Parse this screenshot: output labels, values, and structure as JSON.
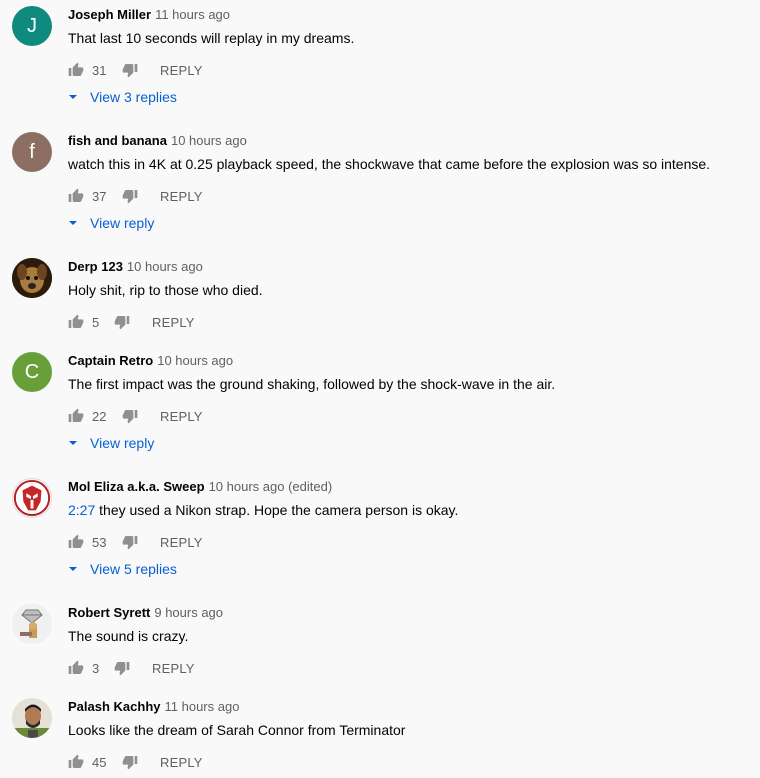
{
  "comments": [
    {
      "author": "Joseph Miller",
      "time": "11 hours ago",
      "text": "That last 10 seconds will replay in my dreams.",
      "likes": "31",
      "reply_label": "REPLY",
      "replies_label": "View 3 replies",
      "avatar_letter": "J",
      "avatar_color": "#0f8a7e"
    },
    {
      "author": "fish and banana",
      "time": "10 hours ago",
      "text": "watch this in 4K at 0.25 playback speed, the shockwave that came before the explosion was so intense.",
      "likes": "37",
      "reply_label": "REPLY",
      "replies_label": "View reply",
      "avatar_letter": "f",
      "avatar_color": "#8d6e63"
    },
    {
      "author": "Derp 123",
      "time": "10 hours ago",
      "text": "Holy shit, rip to those who died.",
      "likes": "5",
      "reply_label": "REPLY",
      "avatar_icon": "dog-photo-avatar"
    },
    {
      "author": "Captain Retro",
      "time": "10 hours ago",
      "text": "The first impact was the ground shaking, followed by the shock-wave in the air.",
      "likes": "22",
      "reply_label": "REPLY",
      "replies_label": "View reply",
      "avatar_letter": "C",
      "avatar_color": "#689f38"
    },
    {
      "author": "Mol Eliza a.k.a. Sweep",
      "time": "10 hours ago (edited)",
      "timestamp_link": "2:27",
      "text": "they used a Nikon strap. Hope the camera person is okay.",
      "likes": "53",
      "reply_label": "REPLY",
      "replies_label": "View 5 replies",
      "avatar_icon": "autobot-logo-avatar"
    },
    {
      "author": "Robert Syrett",
      "time": "9 hours ago",
      "text": "The sound is crazy.",
      "likes": "3",
      "reply_label": "REPLY",
      "avatar_icon": "cartoon-avatar"
    },
    {
      "author": "Palash Kachhy",
      "time": "11 hours ago",
      "text": "Looks like the dream of Sarah Connor from Terminator",
      "likes": "45",
      "reply_label": "REPLY",
      "avatar_icon": "person-photo-avatar"
    }
  ],
  "colors": {
    "background": "#f9f9f9",
    "link_blue": "#065fd4",
    "secondary_text": "#606060",
    "icon_gray": "#909090"
  }
}
